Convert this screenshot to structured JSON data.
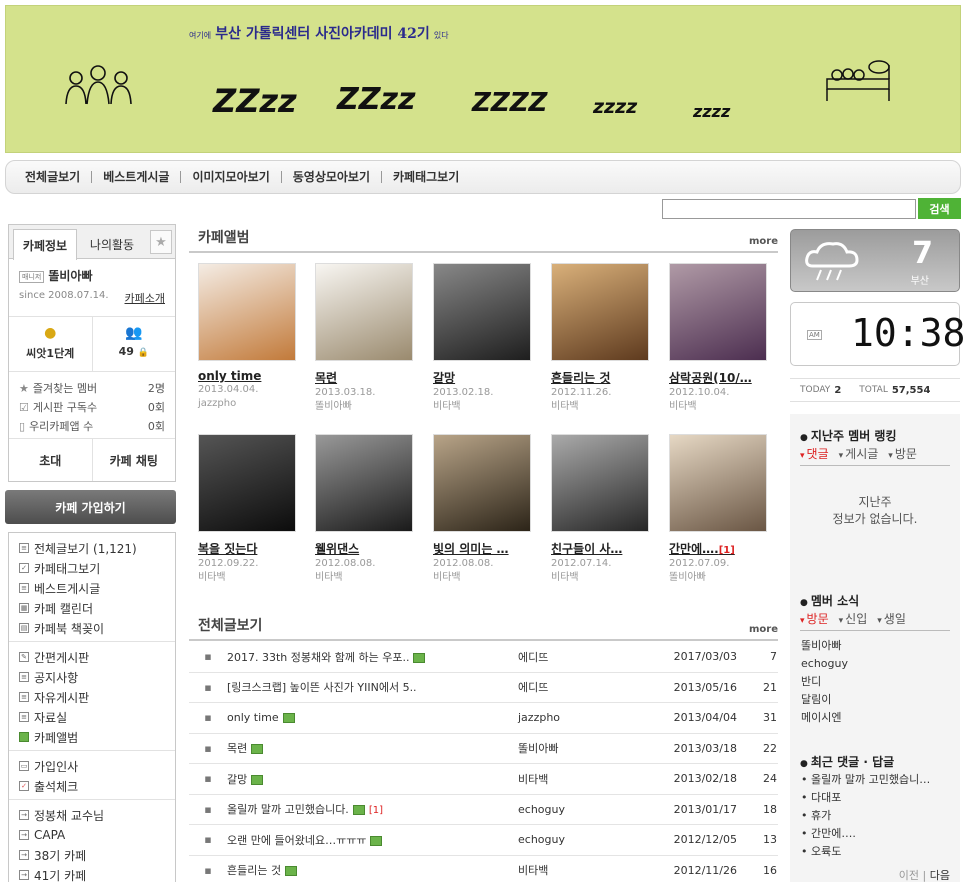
{
  "banner": {
    "prefix": "여기에",
    "title": "부산 가톨릭센터 사진아카데미 42기",
    "suffix": "있다",
    "zzz": [
      "ZZzz",
      "ZZzz",
      "ZZZZ",
      "zzzz",
      "zzzz"
    ]
  },
  "menu": [
    "전체글보기",
    "베스트게시글",
    "이미지모아보기",
    "동영상모아보기",
    "카페태그보기"
  ],
  "search": {
    "button": "검색",
    "placeholder": ""
  },
  "cafe_info": {
    "tab_info": "카페정보",
    "tab_activity": "나의활동",
    "manager_badge": "매니저",
    "manager": "똘비아빠",
    "since": "since 2008.07.14.",
    "intro_link": "카페소개",
    "level": "씨앗1단계",
    "members": "49",
    "stats": [
      {
        "label": "즐겨찾는 멤버",
        "value": "2명"
      },
      {
        "label": "게시판 구독수",
        "value": "0회"
      },
      {
        "label": "우리카페앱 수",
        "value": "0회"
      }
    ],
    "invite": "초대",
    "chat": "카페 채팅"
  },
  "join_button": "카페 가입하기",
  "board_groups": [
    [
      "전체글보기 (1,121)",
      "카페태그보기",
      "베스트게시글",
      "카페 캘린더",
      "카페북 책꽂이"
    ],
    [
      "간편게시판",
      "공지사항",
      "자유게시판",
      "자료실",
      "카페앨범"
    ],
    [
      "가입인사",
      "출석체크"
    ],
    [
      "정봉채 교수님",
      "CAPA",
      "38기 카페",
      "41기 카페"
    ]
  ],
  "album": {
    "title": "카페앨범",
    "more": "more",
    "items": [
      {
        "caption": "only time",
        "date": "2013.04.04.",
        "author": "jazzpho",
        "new": "",
        "c1": "#f4ece4",
        "c2": "#c27a3a"
      },
      {
        "caption": "목련",
        "date": "2013.03.18.",
        "author": "똘비아빠",
        "new": "",
        "c1": "#f8f6f2",
        "c2": "#9a8a6e"
      },
      {
        "caption": "갈망",
        "date": "2013.02.18.",
        "author": "비타백",
        "new": "",
        "c1": "#888",
        "c2": "#1e1e1e"
      },
      {
        "caption": "흔들리는 것",
        "date": "2012.11.26.",
        "author": "비타백",
        "new": "",
        "c1": "#d9b07a",
        "c2": "#5e3a1e"
      },
      {
        "caption": "삼락공원(10/…",
        "date": "2012.10.04.",
        "author": "비타백",
        "new": "",
        "c1": "#b09aa6",
        "c2": "#4c2e50"
      },
      {
        "caption": "복을 짓는다",
        "date": "2012.09.22.",
        "author": "비타백",
        "new": "",
        "c1": "#555",
        "c2": "#0c0c0c"
      },
      {
        "caption": "웰위댄스",
        "date": "2012.08.08.",
        "author": "비타백",
        "new": "",
        "c1": "#999",
        "c2": "#1a1a1a"
      },
      {
        "caption": "빛의 의미는 …",
        "date": "2012.08.08.",
        "author": "비타백",
        "new": "",
        "c1": "#b8a488",
        "c2": "#2c2418"
      },
      {
        "caption": "친구들이 사…",
        "date": "2012.07.14.",
        "author": "비타백",
        "new": "",
        "c1": "#aaa",
        "c2": "#262626"
      },
      {
        "caption": "간만에….",
        "date": "2012.07.09.",
        "author": "똘비아빠",
        "new": "[1]",
        "c1": "#e6d8c4",
        "c2": "#6a5644"
      }
    ]
  },
  "posts": {
    "title": "전체글보기",
    "more": "more",
    "rows": [
      {
        "title": "2017. 33th 정봉채와 함께 하는 우포..",
        "img": true,
        "comments": "",
        "author": "에디뜨",
        "date": "2017/03/03",
        "views": "7"
      },
      {
        "title": "[링크스크랩] 높이뜬 사진가 YIIN에서 5..",
        "img": false,
        "comments": "",
        "author": "에디뜨",
        "date": "2013/05/16",
        "views": "21"
      },
      {
        "title": "only time",
        "img": true,
        "comments": "",
        "author": "jazzpho",
        "date": "2013/04/04",
        "views": "31"
      },
      {
        "title": "목련",
        "img": true,
        "comments": "",
        "author": "똘비아빠",
        "date": "2013/03/18",
        "views": "22"
      },
      {
        "title": "갈망",
        "img": true,
        "comments": "",
        "author": "비타백",
        "date": "2013/02/18",
        "views": "24"
      },
      {
        "title": "올릴까 말까 고민했습니다.",
        "img": true,
        "comments": "[1]",
        "author": "echoguy",
        "date": "2013/01/17",
        "views": "18"
      },
      {
        "title": "오랜 만에 들어왔네요…ㅠㅠㅠ",
        "img": true,
        "comments": "",
        "author": "echoguy",
        "date": "2012/12/05",
        "views": "13"
      },
      {
        "title": "흔들리는 것",
        "img": true,
        "comments": "",
        "author": "비타백",
        "date": "2012/11/26",
        "views": "16"
      }
    ]
  },
  "weather": {
    "temp": "7",
    "city": "부산"
  },
  "clock": {
    "ampm": "AM",
    "time": "10:38"
  },
  "counter": {
    "today_label": "TODAY",
    "today": "2",
    "total_label": "TOTAL",
    "total": "57,554"
  },
  "ranking": {
    "title": "지난주 멤버 랭킹",
    "tabs": [
      "댓글",
      "게시글",
      "방문"
    ],
    "empty_line1": "지난주",
    "empty_line2": "정보가 없습니다."
  },
  "member_news": {
    "title": "멤버 소식",
    "tabs": [
      "방문",
      "신입",
      "생일"
    ],
    "members": [
      "똘비아빠",
      "echoguy",
      "반디",
      "달림이",
      "메이시엔"
    ]
  },
  "recent_comments": {
    "title": "최근 댓글 · 답글",
    "items": [
      "올릴까 말까 고민했습니…",
      "다대포",
      "휴가",
      "간만에….",
      "오륙도"
    ],
    "prev": "이전",
    "next": "다음"
  }
}
